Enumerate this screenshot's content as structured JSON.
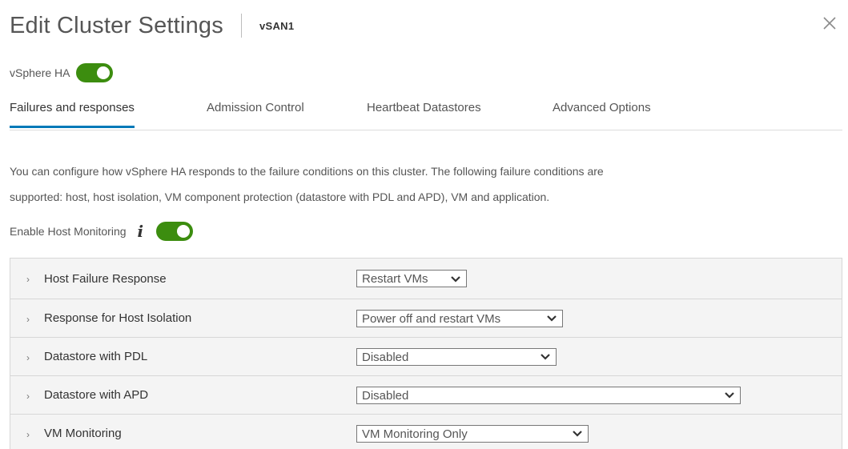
{
  "header": {
    "title": "Edit Cluster Settings",
    "cluster_name": "vSAN1"
  },
  "vsphere_ha": {
    "label": "vSphere HA",
    "enabled": true
  },
  "tabs": [
    {
      "label": "Failures and responses",
      "active": true
    },
    {
      "label": "Admission Control",
      "active": false
    },
    {
      "label": "Heartbeat Datastores",
      "active": false
    },
    {
      "label": "Advanced Options",
      "active": false
    }
  ],
  "description": {
    "line1": "You can configure how vSphere HA responds to the failure conditions on this cluster. The following failure conditions are",
    "line2": "supported: host, host isolation, VM component protection (datastore with PDL and APD), VM and application."
  },
  "host_monitoring": {
    "label": "Enable Host Monitoring",
    "enabled": true
  },
  "settings": [
    {
      "label": "Host Failure Response",
      "value": "Restart VMs"
    },
    {
      "label": "Response for Host Isolation",
      "value": "Power off and restart VMs"
    },
    {
      "label": "Datastore with PDL",
      "value": "Disabled"
    },
    {
      "label": "Datastore with APD",
      "value": "Disabled"
    },
    {
      "label": "VM Monitoring",
      "value": "VM Monitoring Only"
    }
  ],
  "icons": {
    "close": "close-icon",
    "info": "info-icon",
    "expand": "chevron-right-icon",
    "dropdown": "chevron-down-icon"
  },
  "colors": {
    "toggle_on": "#3c8d0f",
    "active_tab_underline": "#0079b8"
  }
}
